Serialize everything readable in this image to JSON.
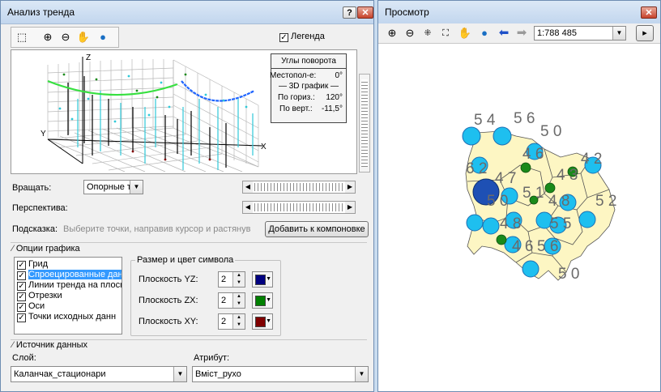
{
  "trend_window": {
    "title": "Анализ тренда",
    "help_label": "?",
    "close_label": "✕",
    "legend_label": "Легенда",
    "legend_checked": true,
    "graph": {
      "axis_z": "Z",
      "axis_x": "X",
      "axis_y": "Y"
    },
    "legend_box": {
      "title": "Углы поворота",
      "location_label": "Местопол-е:",
      "location_value": "0°",
      "mode": "— 3D график —",
      "horiz_label": "По гориз.:",
      "horiz_value": "120°",
      "vert_label": "По верт.:",
      "vert_value": "-11,5°"
    },
    "rotate_label": "Вращать:",
    "rotate_value": "Опорные т",
    "perspective_label": "Перспектива:",
    "hint_label": "Подсказка:",
    "hint_text": "Выберите точки, направив курсор и растянув",
    "add_to_layout_button": "Добавить к компоновке",
    "graph_options": {
      "title": "Опции графика",
      "items": [
        {
          "label": "Грид",
          "checked": true
        },
        {
          "label": "Спроецированные дан",
          "checked": true,
          "selected": true
        },
        {
          "label": "Линии тренда на плоск",
          "checked": true
        },
        {
          "label": "Отрезки",
          "checked": true
        },
        {
          "label": "Оси",
          "checked": true
        },
        {
          "label": "Точки исходных данн",
          "checked": true
        }
      ],
      "symbol_group_title": "Размер и цвет символа",
      "planes": [
        {
          "label": "Плоскость YZ:",
          "size": "2",
          "color": "#000080"
        },
        {
          "label": "Плоскость ZX:",
          "size": "2",
          "color": "#008000"
        },
        {
          "label": "Плоскость XY:",
          "size": "2",
          "color": "#800000"
        }
      ]
    },
    "data_source": {
      "title": "Источник данных",
      "layer_label": "Слой:",
      "layer_value": "Каланчак_стационари",
      "attribute_label": "Атрибут:",
      "attribute_value": "Вміст_рухо"
    }
  },
  "preview_window": {
    "title": "Просмотр",
    "close_label": "✕",
    "scale_value": "1:788 485",
    "map_labels": [
      "5 4",
      "5 6",
      "5 0",
      "4 6",
      "4 2",
      "6 2",
      "4 7",
      "4 3",
      "5 0",
      "5 1",
      "4 8",
      "5 2",
      "4 8",
      "5 5",
      "4 6",
      "5 6",
      "5 6",
      "5 0"
    ]
  }
}
